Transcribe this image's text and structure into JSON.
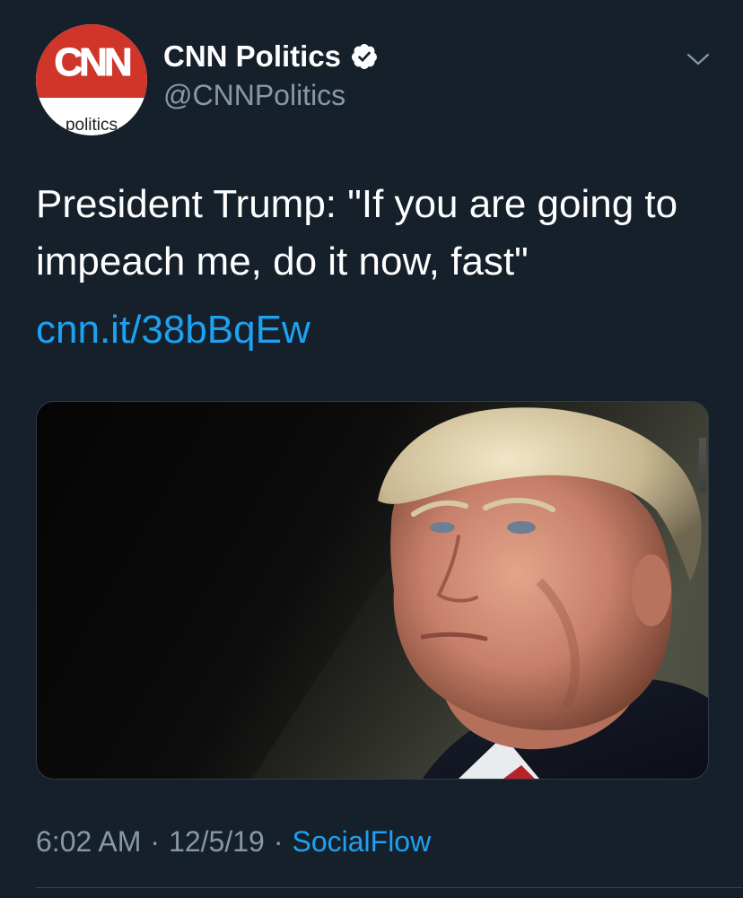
{
  "account": {
    "display_name": "CNN Politics",
    "handle": "@CNNPolitics",
    "avatar_logo": "CNN",
    "avatar_sub": "politics",
    "verified": true
  },
  "tweet": {
    "text": "President Trump: \"If you are going to impeach me, do it now, fast\"",
    "link": "cnn.it/38bBqEw",
    "media_alt_icon": "portrait-photo",
    "time": "6:02 AM",
    "date": "12/5/19",
    "source": "SocialFlow",
    "separator": "·"
  },
  "colors": {
    "background": "#15202b",
    "link": "#1da1f2",
    "secondary_text": "#8899a6",
    "cnn_red": "#d0352a"
  },
  "icons": {
    "verified": "verified-badge-icon",
    "chevron": "chevron-down-icon"
  }
}
